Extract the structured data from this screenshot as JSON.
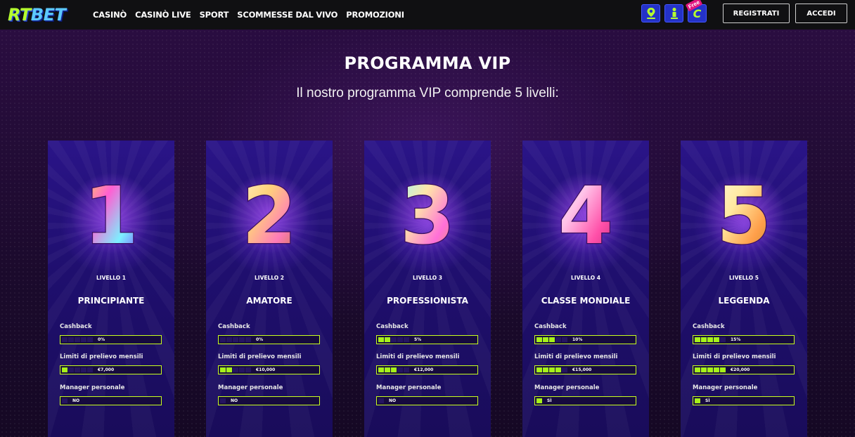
{
  "header": {
    "logo_rt": "RT",
    "logo_bet": "BET",
    "nav": [
      "CASINÒ",
      "CASINÒ LIVE",
      "SPORT",
      "SCOMMESSE DAL VIVO",
      "PROMOZIONI"
    ],
    "icons": [
      "location-pin-icon",
      "info-person-icon",
      "free-chip-icon"
    ],
    "free_badge": "Free",
    "free_icon_glyph": "C",
    "register_label": "REGISTRATI",
    "login_label": "ACCEDI"
  },
  "main": {
    "title": "PROGRAMMA VIP",
    "subtitle": "Il nostro programma VIP comprende 5 livelli:"
  },
  "labels": {
    "cashback": "Cashback",
    "withdraw": "Limiti di prelievo mensili",
    "manager": "Manager personale"
  },
  "levels": [
    {
      "digit": "1",
      "level_label": "LIVELLO 1",
      "name": "PRINCIPIANTE",
      "cashback": "0%",
      "cashback_fill": 0,
      "withdraw": "€7,000",
      "withdraw_fill": 1,
      "manager": "NO",
      "manager_fill": 0
    },
    {
      "digit": "2",
      "level_label": "LIVELLO 2",
      "name": "AMATORE",
      "cashback": "0%",
      "cashback_fill": 0,
      "withdraw": "€10,000",
      "withdraw_fill": 2,
      "manager": "NO",
      "manager_fill": 0
    },
    {
      "digit": "3",
      "level_label": "LIVELLO 3",
      "name": "PROFESSIONISTA",
      "cashback": "5%",
      "cashback_fill": 2,
      "withdraw": "€12,000",
      "withdraw_fill": 3,
      "manager": "NO",
      "manager_fill": 0
    },
    {
      "digit": "4",
      "level_label": "LIVELLO 4",
      "name": "CLASSE MONDIALE",
      "cashback": "10%",
      "cashback_fill": 3,
      "withdraw": "€15,000",
      "withdraw_fill": 4,
      "manager": "SÌ",
      "manager_fill": 1
    },
    {
      "digit": "5",
      "level_label": "LIVELLO 5",
      "name": "LEGGENDA",
      "cashback": "15%",
      "cashback_fill": 4,
      "withdraw": "€20,000",
      "withdraw_fill": 5,
      "manager": "SÌ",
      "manager_fill": 1
    }
  ],
  "colors": {
    "accent": "#a6f21a",
    "bar_border": "#c8ff1f",
    "card_bg": "#1f0f6e",
    "header_bg": "#101012",
    "icon_bg": "#2432c8"
  }
}
